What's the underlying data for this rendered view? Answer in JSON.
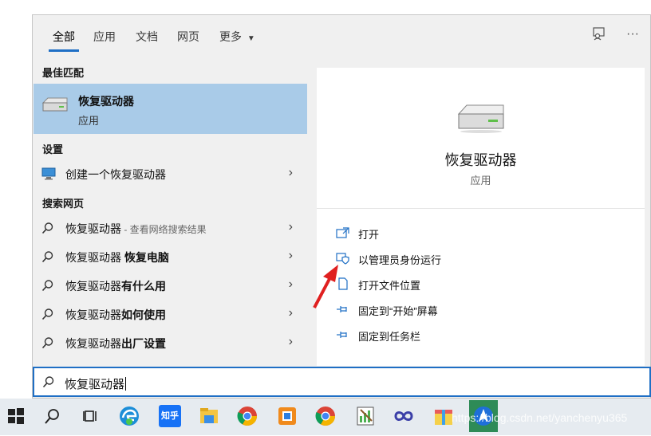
{
  "tabs": [
    {
      "label": "全部",
      "active": true
    },
    {
      "label": "应用"
    },
    {
      "label": "文档"
    },
    {
      "label": "网页"
    },
    {
      "label": "更多"
    }
  ],
  "left": {
    "best_match_title": "最佳匹配",
    "best_match": {
      "name": "恢复驱动器",
      "type": "应用"
    },
    "settings_title": "设置",
    "settings_item": "创建一个恢复驱动器",
    "web_title": "搜索网页",
    "web_items": [
      {
        "query": "恢复驱动器",
        "bold": "",
        "suffix": " - 查看网络搜索结果"
      },
      {
        "query": "恢复驱动器 ",
        "bold": "恢复电脑",
        "suffix": ""
      },
      {
        "query": "恢复驱动器",
        "bold": "有什么用",
        "suffix": ""
      },
      {
        "query": "恢复驱动器",
        "bold": "如何使用",
        "suffix": ""
      },
      {
        "query": "恢复驱动器",
        "bold": "出厂设置",
        "suffix": ""
      }
    ]
  },
  "right": {
    "app_name": "恢复驱动器",
    "app_type": "应用",
    "actions": [
      "打开",
      "以管理员身份运行",
      "打开文件位置",
      "固定到“开始”屏幕",
      "固定到任务栏"
    ]
  },
  "search": {
    "value": "恢复驱动器"
  },
  "taskbar": {
    "zhihu_label": "知乎",
    "icons": [
      "start-icon",
      "search-icon",
      "task-view-icon",
      "edge-icon",
      "zhihu-icon",
      "file-explorer-icon",
      "chrome-icon",
      "app-icon",
      "chrome-icon",
      "editor-icon",
      "infinity-icon",
      "gift-app-icon",
      "navigation-app-icon"
    ]
  },
  "watermark": "https://blog.csdn.net/yanchenyu365",
  "colors": {
    "accent": "#1f6fc5",
    "selection": "#a9cbe8",
    "arrow": "#e02020"
  }
}
